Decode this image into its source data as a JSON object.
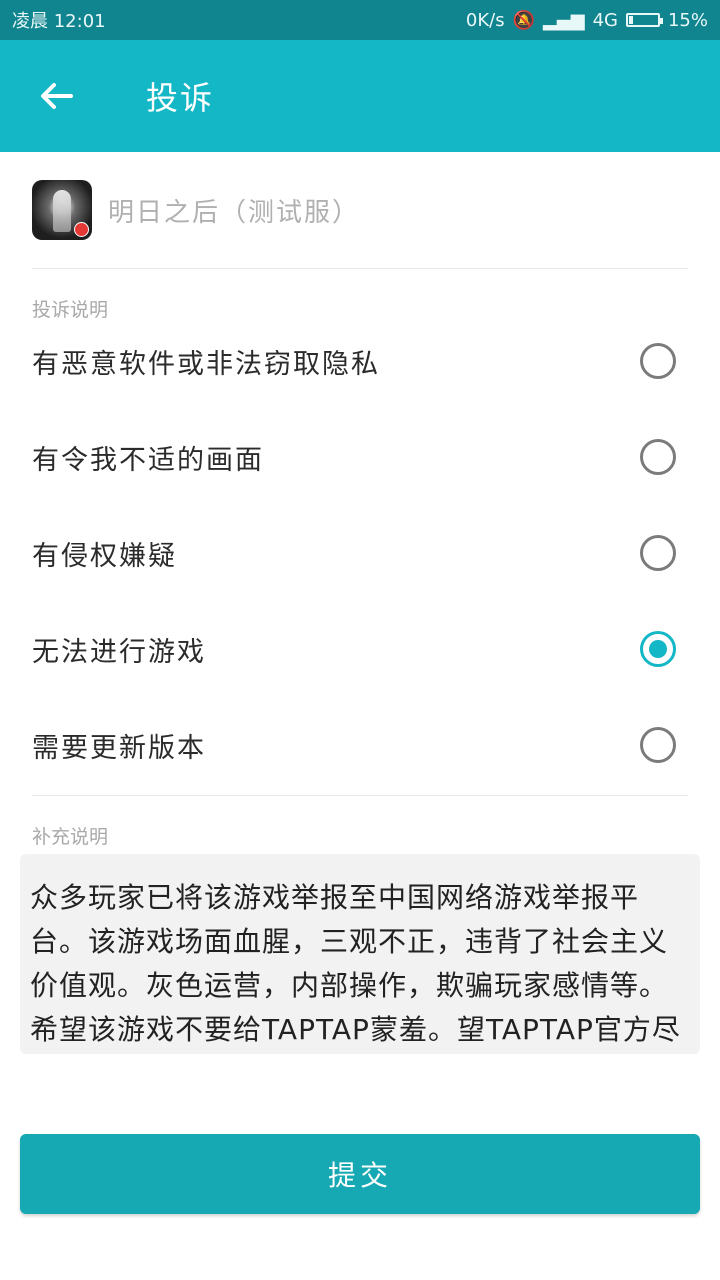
{
  "status": {
    "time": "凌晨 12:01",
    "speed": "0K/s",
    "network": "4G",
    "battery": "15%",
    "battery_level": 0.15
  },
  "header": {
    "title": "投诉",
    "back_icon": "arrow-left-icon"
  },
  "game": {
    "name": "明日之后（测试服）"
  },
  "complaint": {
    "section_label": "投诉说明",
    "options": [
      {
        "label": "有恶意软件或非法窃取隐私",
        "selected": false
      },
      {
        "label": "有令我不适的画面",
        "selected": false
      },
      {
        "label": "有侵权嫌疑",
        "selected": false
      },
      {
        "label": "无法进行游戏",
        "selected": true
      },
      {
        "label": "需要更新版本",
        "selected": false
      }
    ]
  },
  "supplement": {
    "section_label": "补充说明",
    "text": "众多玩家已将该游戏举报至中国网络游戏举报平台。该游戏场面血腥，三观不正，违背了社会主义价值观。灰色运营，内部操作，欺骗玩家感情等。希望该游戏不要给TAPTAP蒙羞。望TAPTAP官方尽早解决，让TAPTAP越来越好"
  },
  "actions": {
    "submit_label": "提交"
  },
  "colors": {
    "primary": "#14b7c6",
    "status_bar": "#11858f",
    "submit": "#16a8b3"
  }
}
